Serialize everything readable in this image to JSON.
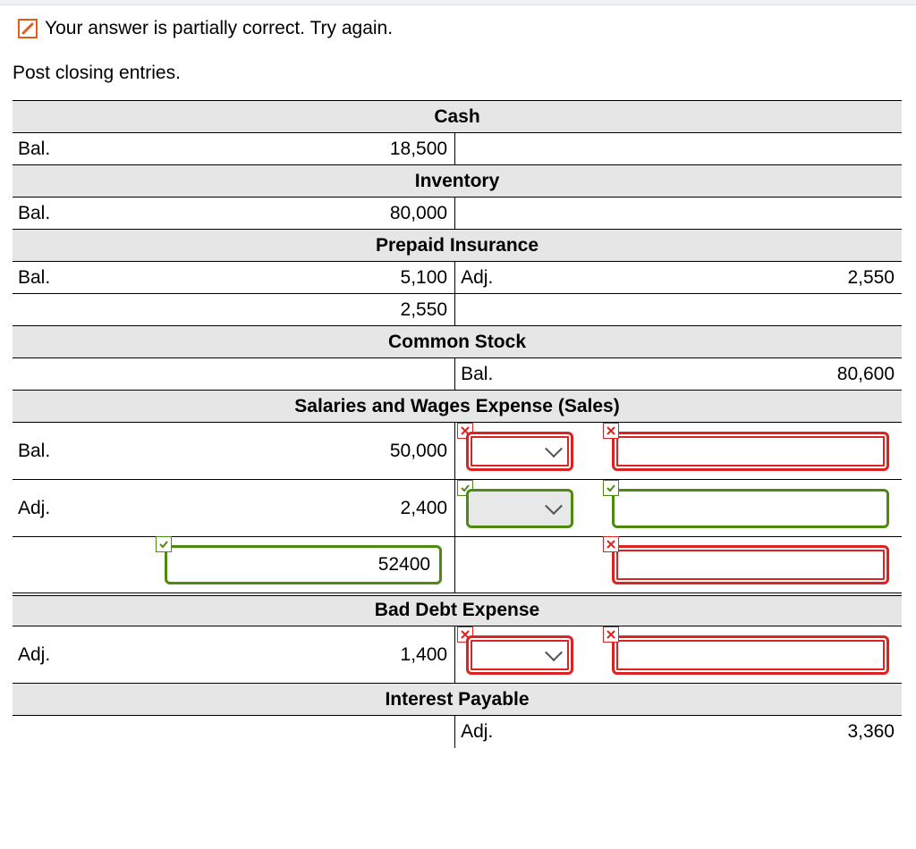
{
  "feedback": {
    "text": "Your answer is partially correct.  Try again."
  },
  "instruction": "Post closing entries.",
  "accounts": {
    "cash": {
      "title": "Cash",
      "r1": {
        "dl": "Bal.",
        "dr": "18,500"
      }
    },
    "inventory": {
      "title": "Inventory",
      "r1": {
        "dl": "Bal.",
        "dr": "80,000"
      }
    },
    "prepaid": {
      "title": "Prepaid Insurance",
      "r1": {
        "dl": "Bal.",
        "dr": "5,100",
        "cl": "Adj.",
        "cr": "2,550"
      },
      "r2": {
        "dr": "2,550"
      }
    },
    "common": {
      "title": "Common Stock",
      "r1": {
        "cl": "Bal.",
        "cr": "80,600"
      }
    },
    "salaries": {
      "title": "Salaries and Wages Expense (Sales)",
      "r1": {
        "dl": "Bal.",
        "dr": "50,000"
      },
      "r2": {
        "dl": "Adj.",
        "dr": "2,400"
      },
      "total_input": "52400"
    },
    "baddebt": {
      "title": "Bad Debt Expense",
      "r1": {
        "dl": "Adj.",
        "dr": "1,400"
      }
    },
    "interest": {
      "title": "Interest Payable",
      "r1": {
        "cl": "Adj.",
        "cr": "3,360"
      }
    }
  }
}
